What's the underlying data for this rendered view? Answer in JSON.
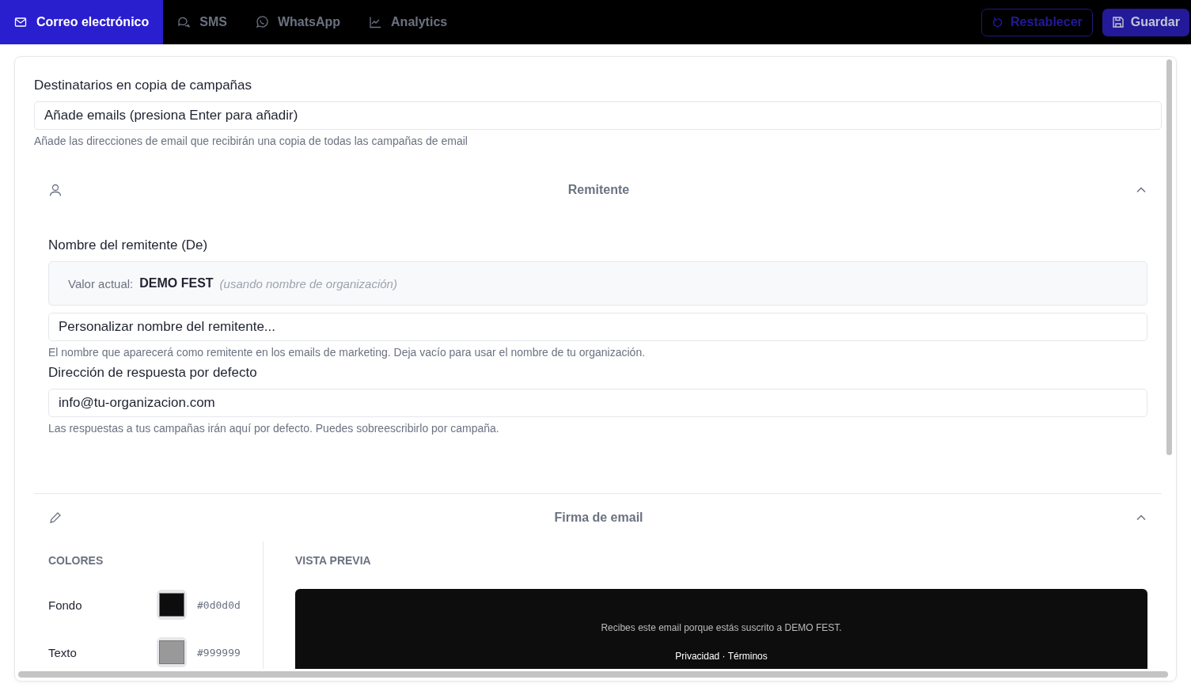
{
  "tabs": [
    {
      "label": "Correo electrónico",
      "selected": true
    },
    {
      "label": "SMS",
      "selected": false
    },
    {
      "label": "WhatsApp",
      "selected": false
    },
    {
      "label": "Analytics",
      "selected": false
    }
  ],
  "actions": {
    "reset": "Restablecer",
    "save": "Guardar"
  },
  "cc": {
    "label": "Destinatarios en copia de campañas",
    "placeholder": "Añade emails (presiona Enter para añadir)",
    "help": "Añade las direcciones de email que recibirán una copia de todas las campañas de email"
  },
  "sender": {
    "title": "Remitente",
    "expanded": true,
    "name_label": "Nombre del remitente (De)",
    "current_label": "Valor actual:",
    "current_value": "DEMO FEST",
    "current_note": "(usando nombre de organización)",
    "name_placeholder": "Personalizar nombre del remitente...",
    "name_help": "El nombre que aparecerá como remitente en los emails de marketing. Deja vacío para usar el nombre de tu organización.",
    "reply_label": "Dirección de respuesta por defecto",
    "reply_placeholder": "info@tu-organizacion.com",
    "reply_help": "Las respuestas a tus campañas irán aquí por defecto. Puedes sobreescribirlo por campaña."
  },
  "signature": {
    "title": "Firma de email",
    "expanded": true,
    "colors_heading": "COLORES",
    "preview_heading": "VISTA PREVIA",
    "colors": [
      {
        "label": "Fondo",
        "color": "#0d0d0d",
        "value": "#0d0d0d"
      },
      {
        "label": "Texto",
        "color": "#999999",
        "value": "#999999"
      }
    ],
    "preview_text": "Recibes este email porque estás suscrito a DEMO FEST.",
    "preview_links": "Privacidad · Términos"
  }
}
